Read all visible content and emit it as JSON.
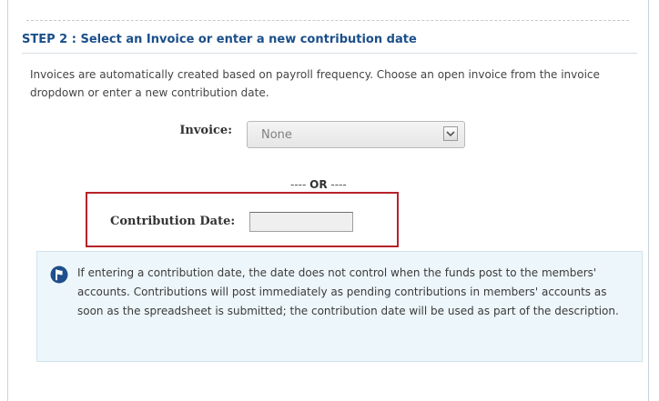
{
  "step": {
    "title": "STEP 2 : Select an Invoice or enter a new contribution date",
    "description": "Invoices are automatically created based on payroll frequency. Choose an open invoice from the invoice dropdown or enter a new contribution date."
  },
  "invoice": {
    "label": "Invoice:",
    "selected": "None",
    "arrow_icon": "chevron-down-icon"
  },
  "separator": {
    "left": "---- ",
    "word": "OR",
    "right": " ----"
  },
  "contribution_date": {
    "label": "Contribution Date:",
    "value": ""
  },
  "info": {
    "icon": "flag-circle-icon",
    "text": "If entering a contribution date, the date does not control when the funds post to the members' accounts. Contributions will post immediately as pending contributions in members' accounts as soon as the spreadsheet is submitted; the contribution date will be used as part of the description."
  },
  "colors": {
    "title": "#1b4f8a",
    "highlight_border": "#b7212a",
    "info_background": "#edf6fa",
    "info_icon": "#1f4e8c"
  }
}
